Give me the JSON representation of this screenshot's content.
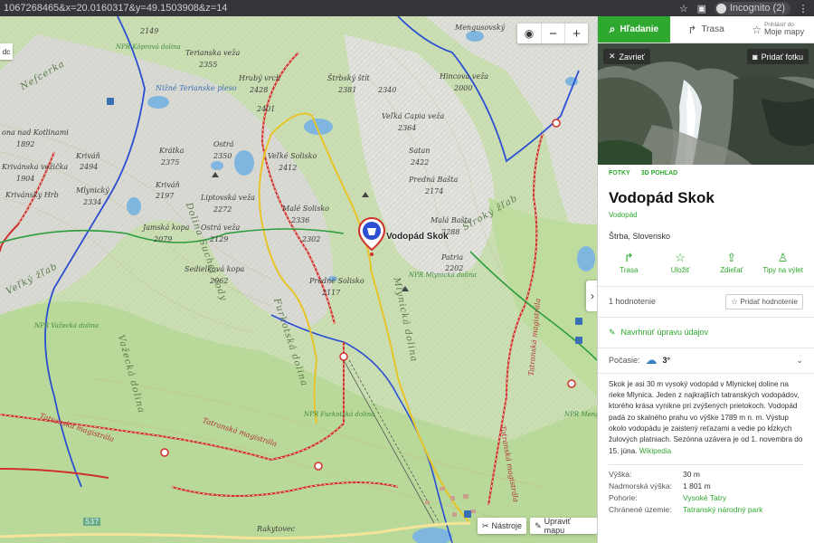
{
  "browser": {
    "url": "1067268465&x=20.0160317&y=49.1503908&z=14",
    "profile_label": "Incognito (2)"
  },
  "map": {
    "poi_label": "Vodopád Skok",
    "left_tab": "dc",
    "labels": {
      "npr_kriva": "NPR Kôprová dolina",
      "peak_2149": "2149",
      "tetranska": "Terianska veža",
      "peak_2355": "2355",
      "hruby_vrch": "Hrubý vrch",
      "peak_2428": "2428",
      "strbsky_stit": "Štrbský štít",
      "peak_2381": "2381",
      "peak_2340": "2340",
      "hincova": "Hincova veža",
      "peak_2000": "2000",
      "mengusovsky": "Mengusovský",
      "nizne_terianske": "Nižné Terianske pleso",
      "peak_2401": "2401",
      "velka_capia": "Veľká Capia veža",
      "peak_2364": "2364",
      "na_kotlinami": "ona nad Kotlinami",
      "peak_1892": "1892",
      "krivan": "Kriváň",
      "peak_2494": "2494",
      "krivanska_vezicka": "Krivánska vežička",
      "peak_1904": "1904",
      "krivansky_hrb": "Krivánsky Hrb",
      "kratka": "Krátka",
      "peak_2375": "2375",
      "ostra": "Ostrá",
      "peak_2350": "2350",
      "velke_solisko": "Veľké Solisko",
      "peak_2412": "2412",
      "satan": "Satan",
      "peak_2422": "2422",
      "predna_basta": "Predná Bašta",
      "peak_2174": "2174",
      "malynicky": "Mlynický",
      "peak_2334": "2334",
      "krivan_small": "Kriváň",
      "peak_2197": "2197",
      "liptovska": "Liptovská veža",
      "peak_2272": "2272",
      "male_solisko": "Malé Solisko",
      "peak_2336": "2336",
      "mala_basta": "Malá Bašta",
      "peak_2288": "2288",
      "jamska_kopa": "Jamská kopa",
      "peak_2079": "2079",
      "ostra_veza": "Ostrá veža",
      "peak_2129": "2129",
      "peak_2302": "2302",
      "patria": "Patria",
      "peak_2202": "2202",
      "sedielkova": "Sedielková kopa",
      "peak_2062": "2062",
      "predne_solisko": "Predné Solisko",
      "peak_2117": "2117",
      "npr_mlynicka": "NPR Mlynická dolina",
      "velky_zlab": "Veľký žľab",
      "siroky_zlab": "Široký žľab",
      "npr_vazecka": "NPR Važecká dolina",
      "furkotska": "Furkotská dolina",
      "vazecka_dolina": "Važecká dolina",
      "dolina_suchej": "Dolina Suchej vody",
      "mlynicka_dolina": "Mlynická dolina",
      "npr_furkotska": "NPR Furkotská dolina",
      "npr_mengusovska": "NPR Mengusovská dolina",
      "tatranska_magistrala_1": "Tatranská magistrála",
      "tatranska_magistrala_2": "Tatranská magistrála",
      "tatranska_magistrala_3": "Tatranská magistrála",
      "tatranska_magistrala_4": "Tatranská magistrála",
      "rakytovec": "Rakytovec",
      "road_537": "537",
      "nefcerka": "Nefcerka"
    },
    "tools_label": "Nástroje",
    "edit_label": "Upraviť mapu"
  },
  "sidebar": {
    "tabs": {
      "search": "Hľadanie",
      "route": "Trasa",
      "mymaps_small": "Prihlásiť do",
      "mymaps": "Moje mapy"
    },
    "close_label": "Zavrieť",
    "add_photo_label": "Pridať fotku",
    "photo_tabs": [
      "FOTKY",
      "3D POHĽAD"
    ],
    "title": "Vodopád Skok",
    "category": "Vodopád",
    "location": "Štrba, Slovensko",
    "actions": [
      {
        "icon": "route-icon",
        "label": "Trasa"
      },
      {
        "icon": "star-icon",
        "label": "Uložiť"
      },
      {
        "icon": "share-icon",
        "label": "Zdieľať"
      },
      {
        "icon": "hiker-icon",
        "label": "Tipy na výlet"
      }
    ],
    "rating_count": "1 hodnotenie",
    "rating_button": "Pridať hodnotenie",
    "suggest_edit": "Navrhnúť úpravu údajov",
    "weather_label": "Počasie:",
    "weather_temp": "3°",
    "description": "Skok je asi 30 m vysoký vodopád v Mlynickej doline na rieke Mlynica. Jeden z najkrajších tatranských vodopádov, ktorého krása vynikne pri zvýšených prietokoch. Vodopád padá zo skalného prahu vo výške 1789 m n. m. Výstup okolo vodopádu je zaistený reťazami a vedie po kĺzkych žulových platniach. Sezónna uzávera je od 1. novembra do 15. júna.",
    "wiki_link": "Wikipedia",
    "facts": [
      {
        "k": "Výška:",
        "v": "30 m",
        "link": false
      },
      {
        "k": "Nadmorská výška:",
        "v": "1 801 m",
        "link": false
      },
      {
        "k": "Pohorie:",
        "v": "Vysoké Tatry",
        "link": true
      },
      {
        "k": "Chránené územie:",
        "v": "Tatranský národný park",
        "link": true
      }
    ]
  },
  "colors": {
    "accent": "#2fa82f",
    "trail_red": "#d0302a",
    "trail_blue": "#2b4fd0",
    "trail_yellow": "#e8c42a",
    "trail_green": "#2e9e3e",
    "water": "#7fb6e0",
    "forest": "#b9d99a"
  }
}
